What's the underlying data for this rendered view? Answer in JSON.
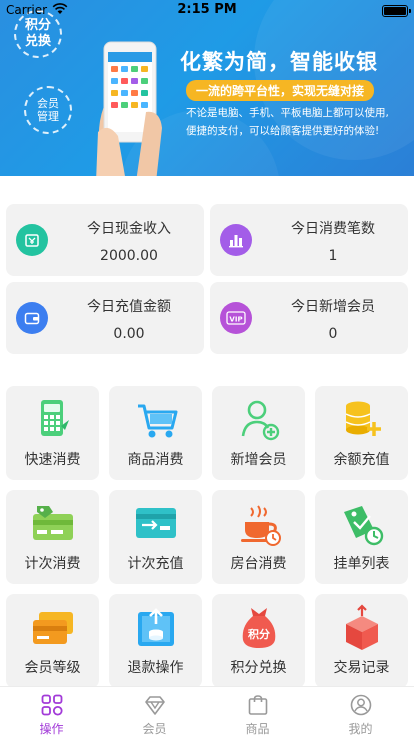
{
  "status_bar": {
    "carrier": "Carrier",
    "time": "2:15 PM"
  },
  "banner": {
    "badge1_line1": "积分",
    "badge1_line2": "兑换",
    "badge2_line1": "会员",
    "badge2_line2": "管理",
    "title": "化繁为简，智能收银",
    "pill": "一流的跨平台性，实现无缝对接",
    "desc_line1": "不论是电脑、手机、平板电脑上都可以使用,",
    "desc_line2": "便捷的支付，可以给顾客提供更好的体验!"
  },
  "stats": [
    {
      "label": "今日现金收入",
      "value": "2000.00",
      "icon": "cash-icon",
      "color": "#23c3a0"
    },
    {
      "label": "今日消费笔数",
      "value": "1",
      "icon": "bar-chart-icon",
      "color": "#a35de8"
    },
    {
      "label": "今日充值金额",
      "value": "0.00",
      "icon": "wallet-icon",
      "color": "#3c7ef0"
    },
    {
      "label": "今日新增会员",
      "value": "0",
      "icon": "vip-icon",
      "color": "#b652d8"
    }
  ],
  "actions": [
    {
      "label": "快速消费",
      "icon": "calculator-icon"
    },
    {
      "label": "商品消费",
      "icon": "shopping-cart-icon"
    },
    {
      "label": "新增会员",
      "icon": "add-member-icon"
    },
    {
      "label": "余额充值",
      "icon": "coin-stack-icon"
    },
    {
      "label": "计次消费",
      "icon": "count-card-icon"
    },
    {
      "label": "计次充值",
      "icon": "card-transfer-icon"
    },
    {
      "label": "房台消费",
      "icon": "teacup-icon"
    },
    {
      "label": "挂单列表",
      "icon": "pending-tag-icon"
    },
    {
      "label": "会员等级",
      "icon": "member-cards-icon"
    },
    {
      "label": "退款操作",
      "icon": "refund-icon"
    },
    {
      "label": "积分兑换",
      "icon": "points-bag-icon"
    },
    {
      "label": "交易记录",
      "icon": "records-box-icon"
    }
  ],
  "tabs": [
    {
      "label": "操作",
      "icon": "operate-icon",
      "active": true
    },
    {
      "label": "会员",
      "icon": "member-diamond-icon",
      "active": false
    },
    {
      "label": "商品",
      "icon": "goods-bag-icon",
      "active": false
    },
    {
      "label": "我的",
      "icon": "profile-icon",
      "active": false
    }
  ],
  "colors": {
    "accent": "#a23ad8",
    "banner": "#1f9be6",
    "pill": "#f6b623"
  }
}
